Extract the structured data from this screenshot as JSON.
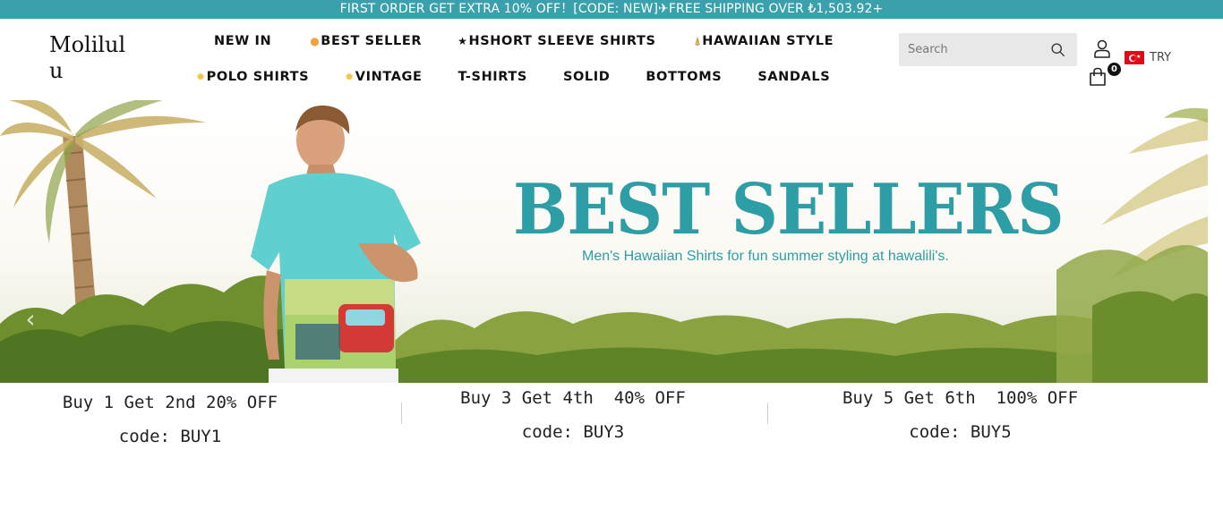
{
  "announcement": "FIRST ORDER GET EXTRA 10% OFF！[CODE: NEW]✈FREE SHIPPING OVER ₺1,503.92+",
  "header": {
    "logo": "Molilulu",
    "nav_row1": [
      {
        "label": "NEW IN",
        "icon": ""
      },
      {
        "label": "BEST SELLER",
        "icon": "fire-icon"
      },
      {
        "label": "HSHORT SLEEVE SHIRTS",
        "icon": "star-icon"
      },
      {
        "label": "HAWAIIAN STYLE",
        "icon": "palm-tree-icon"
      }
    ],
    "nav_row2": [
      {
        "label": "POLO SHIRTS",
        "icon": "sun-icon"
      },
      {
        "label": "VINTAGE",
        "icon": "sun-icon"
      },
      {
        "label": "T-SHIRTS",
        "icon": ""
      },
      {
        "label": "SOLID",
        "icon": ""
      },
      {
        "label": "BOTTOMS",
        "icon": ""
      },
      {
        "label": "SANDALS",
        "icon": ""
      }
    ],
    "search_placeholder": "Search",
    "cart_count": "0",
    "currency": "TRY"
  },
  "hero": {
    "title": "BEST SELLERS",
    "subtitle": "Men's Hawaiian Shirts  for fun summer styling at hawalili's.",
    "prev_arrow": "‹"
  },
  "promos": [
    {
      "title": "Buy 1 Get 2nd 20% OFF",
      "code": "code: BUY1"
    },
    {
      "title": "Buy 3 Get 4th  40% OFF",
      "code": "code: BUY3"
    },
    {
      "title": "Buy 5 Get 6th  100% OFF",
      "code": "code: BUY5"
    }
  ],
  "colors": {
    "accent": "#3aa0ab",
    "hero_title": "#2d9ea6",
    "badge": "#111111"
  }
}
